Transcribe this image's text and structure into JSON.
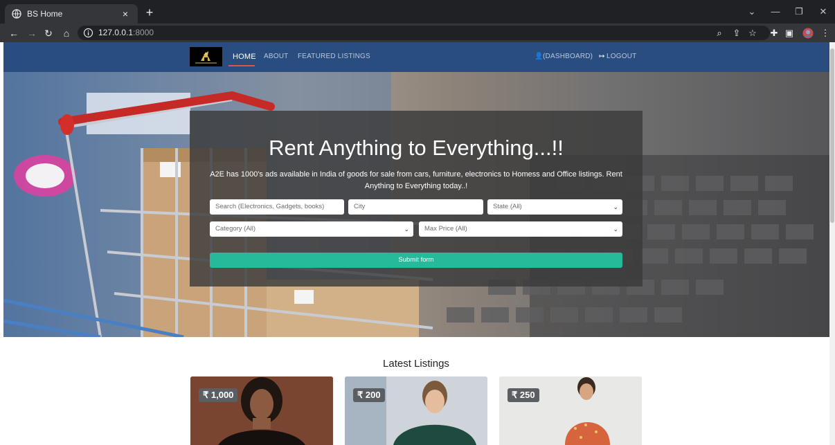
{
  "browser": {
    "tab_title": "BS Home",
    "tab_close": "×",
    "new_tab": "+",
    "url_host": "127.0.0.1",
    "url_port": ":8000",
    "window_controls": [
      "⌄",
      "—",
      "❐",
      "✕"
    ]
  },
  "nav": {
    "links": [
      "HOME",
      "ABOUT",
      "FEATURED LISTINGS"
    ],
    "dashboard": "(DASHBOARD)",
    "logout": "LOGOUT",
    "bar_color": "#2a4d80"
  },
  "hero": {
    "title": "Rent Anything to Everything...!!",
    "description": "A2E has 1000's ads available in India of goods for sale from cars, furniture, electronics to Homess and Office listings. Rent Anything to Everything today..!",
    "search_placeholder": "Search (Electronics, Gadgets, books)",
    "city_placeholder": "City",
    "state_select": "State (All)",
    "category_select": "Category (All)",
    "max_price_select": "Max Price (All)",
    "submit_label": "Submit form",
    "submit_color": "#26b99a"
  },
  "listings": {
    "title": "Latest Listings",
    "items": [
      {
        "price": "₹ 1,000"
      },
      {
        "price": "₹ 200"
      },
      {
        "price": "₹ 250"
      }
    ]
  }
}
